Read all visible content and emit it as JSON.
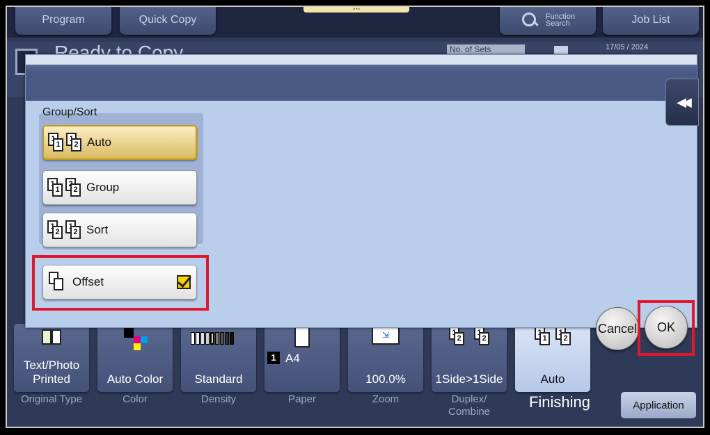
{
  "topbar": {
    "program": "Program",
    "quick_copy": "Quick Copy",
    "function_search_line1": "Function",
    "function_search_line2": "Search",
    "job_list": "Job List",
    "grip": "«•»"
  },
  "status": {
    "ready": "Ready to Copy",
    "no_of_sets": "No. of Sets",
    "date": "17/05 / 2024"
  },
  "dialog": {
    "group_label": "Group/Sort",
    "options": [
      {
        "label": "Auto",
        "icons": [
          [
            "1",
            "1"
          ],
          [
            "1",
            "2"
          ]
        ],
        "selected": true
      },
      {
        "label": "Group",
        "icons": [
          [
            "1",
            "1"
          ],
          [
            "2",
            "2"
          ]
        ],
        "selected": false
      },
      {
        "label": "Sort",
        "icons": [
          [
            "1",
            "2"
          ],
          [
            "1",
            "2"
          ]
        ],
        "selected": false
      }
    ],
    "offset_label": "Offset",
    "offset_checked": true,
    "collapse_glyph": "◀◀"
  },
  "tiles": [
    {
      "value": "Text/Photo\nPrinted",
      "label": "Original Type"
    },
    {
      "value": "Auto Color",
      "label": "Color"
    },
    {
      "value": "Standard",
      "label": "Density"
    },
    {
      "value": "A4",
      "label": "Paper",
      "badge": "1"
    },
    {
      "value": "100.0%",
      "label": "Zoom"
    },
    {
      "value": "1Side>1Side",
      "label": "Duplex/\nCombine"
    },
    {
      "value": "Auto",
      "label": "Finishing",
      "active": true
    }
  ],
  "buttons": {
    "cancel": "Cancel",
    "ok": "OK",
    "application": "Application"
  },
  "colors": {
    "highlight_red": "#e0182b",
    "selected_gold": "#d9ba61",
    "check_yellow": "#f6d100"
  }
}
